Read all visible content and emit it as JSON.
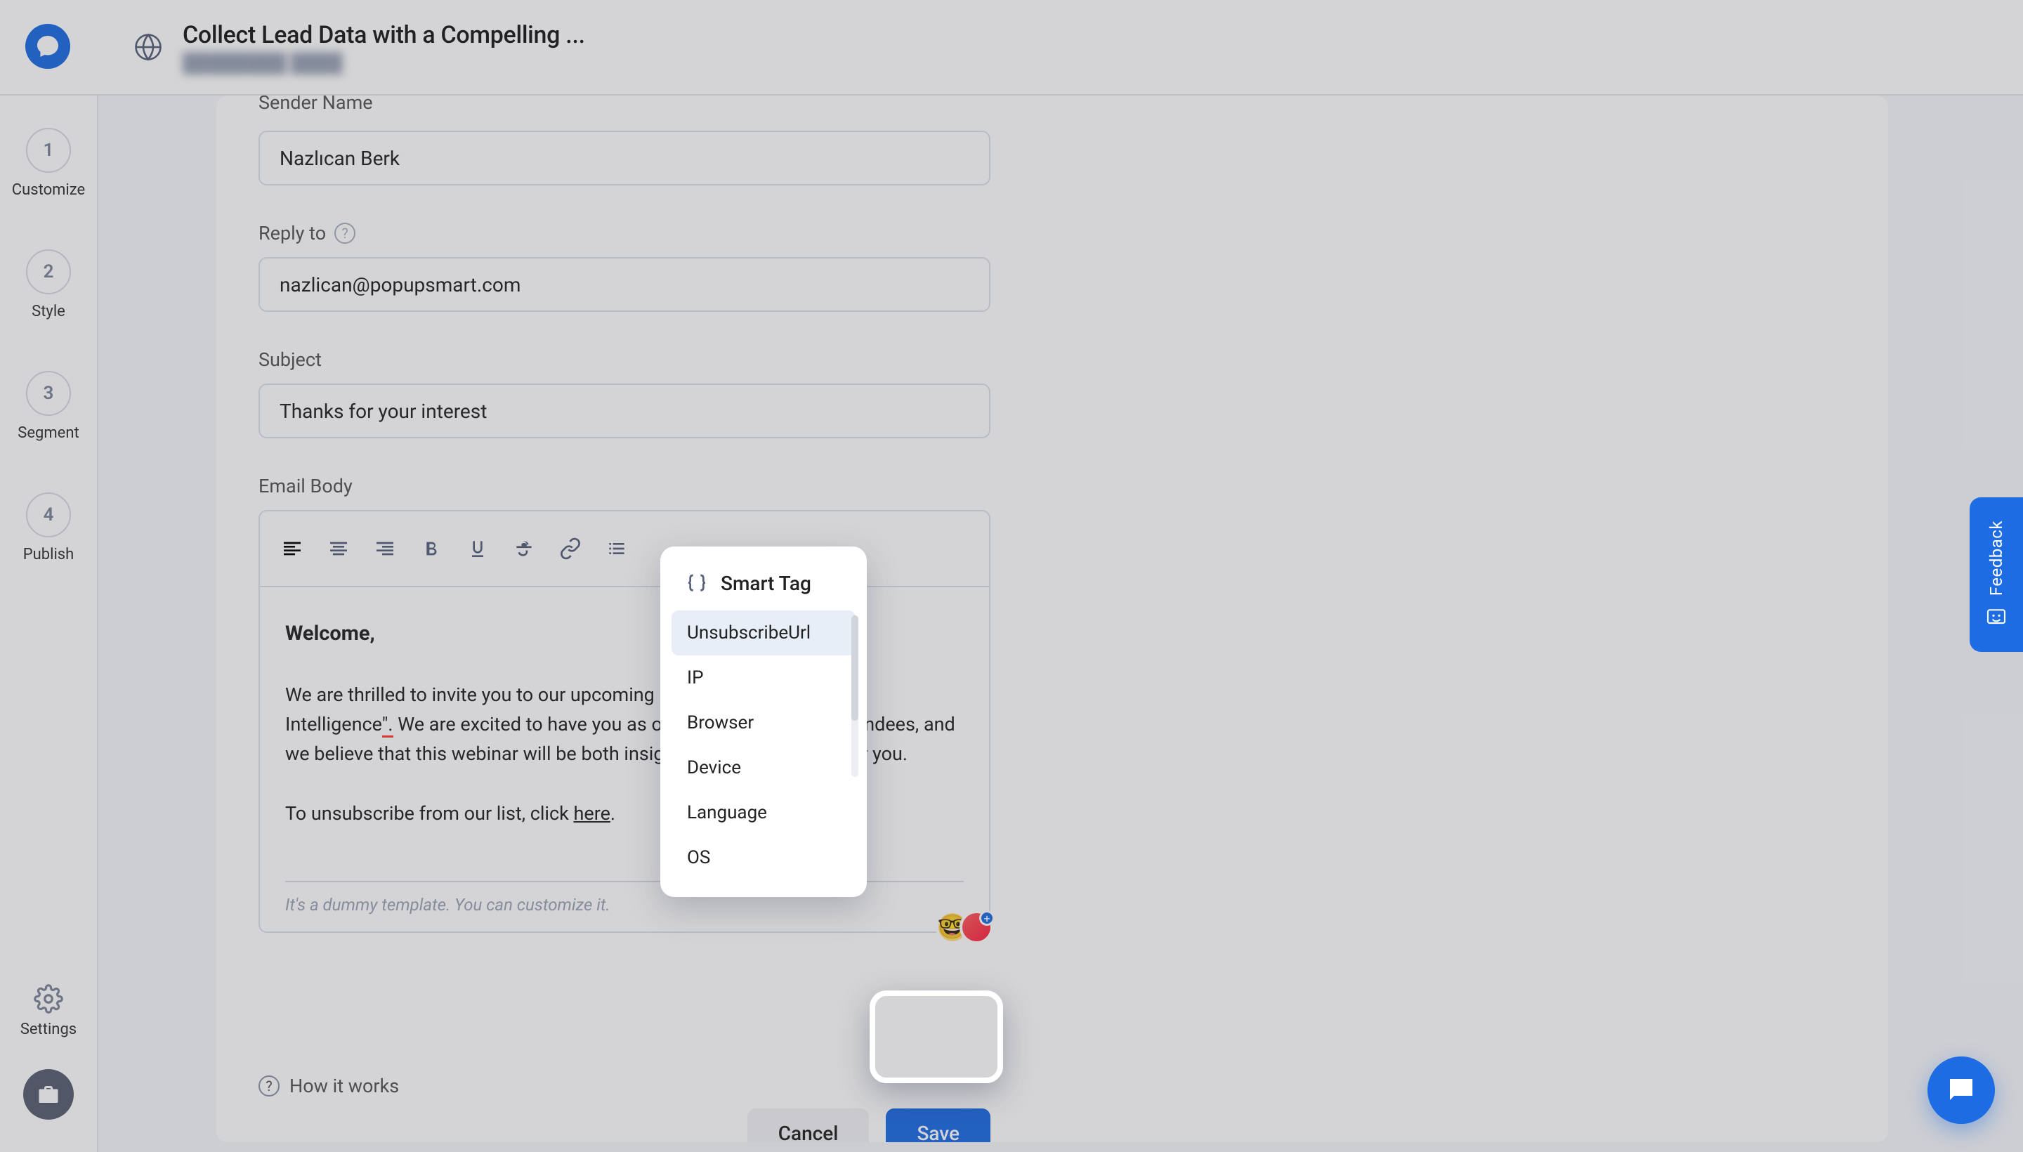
{
  "header": {
    "title": "Collect Lead Data with a Compelling ...",
    "subtitle": "████████ ████"
  },
  "sidebar": {
    "steps": [
      {
        "num": "1",
        "label": "Customize"
      },
      {
        "num": "2",
        "label": "Style"
      },
      {
        "num": "3",
        "label": "Segment"
      },
      {
        "num": "4",
        "label": "Publish"
      }
    ],
    "settings_label": "Settings"
  },
  "form": {
    "sender_name_label": "Sender Name",
    "sender_name_value": "Nazlıcan Berk",
    "reply_to_label": "Reply to",
    "reply_to_value": "nazlican@popupsmart.com",
    "subject_label": "Subject",
    "subject_value": "Thanks for your interest",
    "email_body_label": "Email Body"
  },
  "editor": {
    "welcome": "Welcome,",
    "para1a": "We are thrilled to invite you to our upcoming",
    "para1b": " \"The Future of Artificial Intelligence",
    "para1c": "\".",
    "para1d": " We are excited to have you as one of our registered attendees, and we believe that this webinar will be both insightful and informative for you.",
    "unsub_prefix": "To unsubscribe from our list, click ",
    "unsub_link": "here",
    "unsub_suffix": ".",
    "footnote": "It's a dummy template. You can customize it."
  },
  "smart_tag": {
    "title": "Smart Tag",
    "items": [
      "UnsubscribeUrl",
      "IP",
      "Browser",
      "Device",
      "Language",
      "OS"
    ]
  },
  "buttons": {
    "cancel": "Cancel",
    "save": "Save"
  },
  "how_it_works": "How it works",
  "feedback_label": "Feedback"
}
